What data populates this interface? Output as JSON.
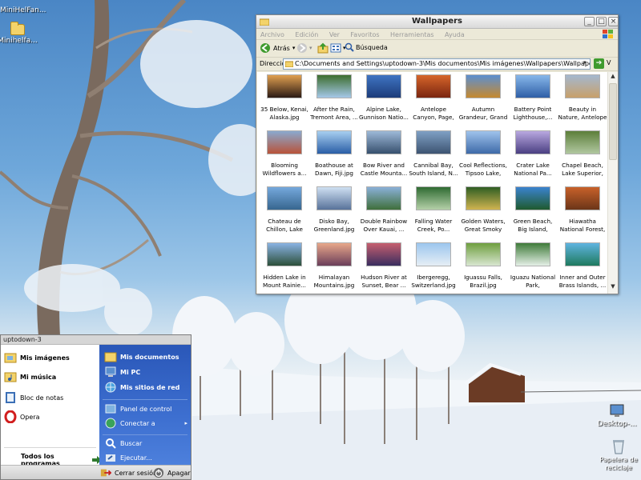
{
  "desktop": {
    "icons": [
      {
        "label": "MiniHelFan..."
      },
      {
        "label": "Minihelfa..."
      },
      {
        "label": "Desktop-..."
      },
      {
        "label": "Papelera de reciclaje"
      }
    ]
  },
  "window": {
    "title": "Wallpapers",
    "menu": [
      "Archivo",
      "Edición",
      "Ver",
      "Favoritos",
      "Herramientas",
      "Ayuda"
    ],
    "toolbar": {
      "back_label": "Atrás",
      "search_label": "Búsqueda"
    },
    "address": {
      "label": "Dirección",
      "value": "C:\\Documents and Settings\\uptodown-3\\Mis documentos\\Mis imágenes\\Wallpapers\\Wallpapers",
      "go_suffix": "V"
    },
    "thumbnails": [
      {
        "caption": "35 Below, Kenai, Alaska.jpg",
        "colors": [
          "#e0a050",
          "#2b1a14"
        ]
      },
      {
        "caption": "After the Rain, Tremont Area, ...",
        "colors": [
          "#3d6e2f",
          "#a5c8e8"
        ]
      },
      {
        "caption": "Alpine Lake, Gunnison Natio...",
        "colors": [
          "#3f74c2",
          "#1c3c7a"
        ]
      },
      {
        "caption": "Antelope Canyon, Page, Arizona.jpg",
        "colors": [
          "#d6652a",
          "#7a2510"
        ]
      },
      {
        "caption": "Autumn Grandeur, Grand Teton Na...",
        "colors": [
          "#5c8fd0",
          "#c6892f"
        ]
      },
      {
        "caption": "Battery Point Lighthouse,...",
        "colors": [
          "#87b7ea",
          "#2f5fa6"
        ]
      },
      {
        "caption": "Beauty in Nature, Antelope Valle...",
        "colors": [
          "#a4b8cf",
          "#c8a06a"
        ]
      },
      {
        "caption": "Blooming Wildflowers a...",
        "colors": [
          "#8aa9cf",
          "#b8533a"
        ]
      },
      {
        "caption": "Boathouse at Dawn, Fiji.jpg",
        "colors": [
          "#a8cff0",
          "#2a5ea6"
        ]
      },
      {
        "caption": "Bow River and Castle Mounta...",
        "colors": [
          "#9db9d8",
          "#37506e"
        ]
      },
      {
        "caption": "Cannibal Bay, South Island, N...",
        "colors": [
          "#7fa0c4",
          "#3d5472"
        ]
      },
      {
        "caption": "Cool Reflections, Tipsoo Lake, Mo...",
        "colors": [
          "#9fc3ec",
          "#3e6aa8"
        ]
      },
      {
        "caption": "Crater Lake National Pa...",
        "colors": [
          "#b9a8e0",
          "#4a3f82"
        ]
      },
      {
        "caption": "Chapel Beach, Lake Superior, Picture...",
        "colors": [
          "#5d7f3a",
          "#b1c7a0"
        ]
      },
      {
        "caption": "Chateau de Chillon, Lake Geneva, S...",
        "colors": [
          "#75a8dc",
          "#37668f"
        ]
      },
      {
        "caption": "Disko Bay, Greenland.jpg",
        "colors": [
          "#cfe0f2",
          "#58729a"
        ]
      },
      {
        "caption": "Double Rainbow Over Kauai, ...",
        "colors": [
          "#8ab0d8",
          "#3f6f3b"
        ]
      },
      {
        "caption": "Falling Water Creek, Po...",
        "colors": [
          "#2f6b32",
          "#b4d0a8"
        ]
      },
      {
        "caption": "Golden Waters, Great Smoky Mo...",
        "colors": [
          "#2f5e23",
          "#d0b450"
        ]
      },
      {
        "caption": "Green Beach, Big Island, Hawaii.jpg",
        "colors": [
          "#3b83cf",
          "#1f5a2e"
        ]
      },
      {
        "caption": "Hiawatha National Forest, Upper ...",
        "colors": [
          "#c8612a",
          "#6b3518"
        ]
      },
      {
        "caption": "Hidden Lake in Mount Rainie...",
        "colors": [
          "#8ab3e3",
          "#2c4f3a"
        ]
      },
      {
        "caption": "Himalayan Mountains.jpg",
        "colors": [
          "#e8a78a",
          "#6b3e5a"
        ]
      },
      {
        "caption": "Hudson River at Sunset, Bear ...",
        "colors": [
          "#c65f6f",
          "#3a2d5f"
        ]
      },
      {
        "caption": "Ibergeregg, Switzerland.jpg",
        "colors": [
          "#9cc6ee",
          "#e6eef5"
        ]
      },
      {
        "caption": "Iguassu Falls, Brazil.jpg",
        "colors": [
          "#6f9f3f",
          "#d8e6d0"
        ]
      },
      {
        "caption": "Iguazu National Park, Argentina.jpg",
        "colors": [
          "#3f7b3a",
          "#e4efe6"
        ]
      },
      {
        "caption": "Inner and Outer Brass Islands, ...",
        "colors": [
          "#5fb4e0",
          "#1f7a5f"
        ]
      }
    ]
  },
  "startmenu": {
    "user": "uptodown-3",
    "left_items": [
      {
        "label": "Mis imágenes",
        "bold": true
      },
      {
        "label": "Mi música",
        "bold": true
      },
      {
        "label": "Bloc de notas",
        "bold": false
      },
      {
        "label": "Opera",
        "bold": false
      }
    ],
    "all_programs": "Todos los programas",
    "right_items": [
      {
        "label": "Mis documentos",
        "bold": true
      },
      {
        "label": "Mi PC",
        "bold": true
      },
      {
        "label": "Mis sitios de red",
        "bold": true
      },
      {
        "label": "Panel de control",
        "bold": false
      },
      {
        "label": "Conectar a",
        "bold": false
      },
      {
        "label": "Buscar",
        "bold": false
      },
      {
        "label": "Ejecutar...",
        "bold": false
      }
    ],
    "logoff": "Cerrar sesión",
    "shutdown": "Apagar"
  }
}
